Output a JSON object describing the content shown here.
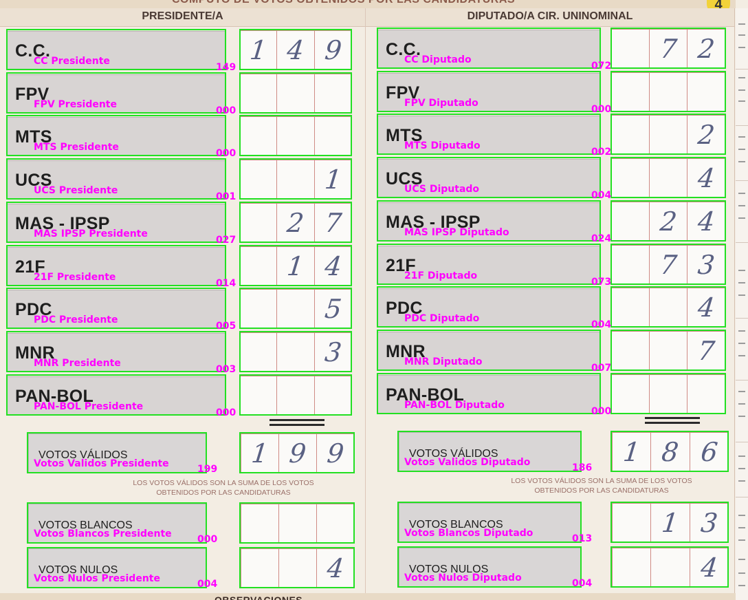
{
  "form": {
    "top_heading": "CÓMPUTO DE VOTOS OBTENIDOS POR LAS CANDIDATURAS",
    "page_number": "4",
    "left_header": "PRESIDENTE/A",
    "right_header": "DIPUTADO/A CIR. UNINOMINAL",
    "bottom_heading": "OBSERVACIONES",
    "note_line1": "LOS VOTOS VÁLIDOS SON LA SUMA DE LOS VOTOS",
    "note_line2": "OBTENIDOS POR LAS CANDIDATURAS"
  },
  "annotation_colors": {
    "box": "#22e022",
    "label": "#ff00ff"
  },
  "presidente": {
    "parties": [
      {
        "party": "C.C.",
        "tag": "CC Presidente",
        "value": "149",
        "digits": [
          "1",
          "4",
          "9"
        ]
      },
      {
        "party": "FPV",
        "tag": "FPV Presidente",
        "value": "000",
        "digits": [
          "",
          "",
          ""
        ]
      },
      {
        "party": "MTS",
        "tag": "MTS Presidente",
        "value": "000",
        "digits": [
          "",
          "",
          ""
        ]
      },
      {
        "party": "UCS",
        "tag": "UCS Presidente",
        "value": "001",
        "digits": [
          "",
          "",
          "1"
        ]
      },
      {
        "party": "MAS - IPSP",
        "tag": "MAS IPSP Presidente",
        "value": "027",
        "digits": [
          "",
          "2",
          "7"
        ]
      },
      {
        "party": "21F",
        "tag": "21F Presidente",
        "value": "014",
        "digits": [
          "",
          "1",
          "4"
        ]
      },
      {
        "party": "PDC",
        "tag": "PDC Presidente",
        "value": "005",
        "digits": [
          "",
          "",
          "5"
        ]
      },
      {
        "party": "MNR",
        "tag": "MNR Presidente",
        "value": "003",
        "digits": [
          "",
          "",
          "3"
        ]
      },
      {
        "party": "PAN-BOL",
        "tag": "PAN-BOL Presidente",
        "value": "000",
        "digits": [
          "",
          "",
          ""
        ]
      }
    ],
    "totals": [
      {
        "label": "VOTOS VÁLIDOS",
        "tag": "Votos Validos Presidente",
        "value": "199",
        "digits": [
          "1",
          "9",
          "9"
        ]
      },
      {
        "label": "VOTOS BLANCOS",
        "tag": "Votos Blancos Presidente",
        "value": "000",
        "digits": [
          "",
          "",
          ""
        ]
      },
      {
        "label": "VOTOS NULOS",
        "tag": "Votos Nulos Presidente",
        "value": "004",
        "digits": [
          "",
          "",
          "4"
        ]
      }
    ]
  },
  "diputado": {
    "parties": [
      {
        "party": "C.C.",
        "tag": "CC Diputado",
        "value": "072",
        "digits": [
          "",
          "7",
          "2"
        ]
      },
      {
        "party": "FPV",
        "tag": "FPV Diputado",
        "value": "000",
        "digits": [
          "",
          "",
          ""
        ]
      },
      {
        "party": "MTS",
        "tag": "MTS Diputado",
        "value": "002",
        "digits": [
          "",
          "",
          "2"
        ]
      },
      {
        "party": "UCS",
        "tag": "UCS Diputado",
        "value": "004",
        "digits": [
          "",
          "",
          "4"
        ]
      },
      {
        "party": "MAS - IPSP",
        "tag": "MAS IPSP Diputado",
        "value": "024",
        "digits": [
          "",
          "2",
          "4"
        ]
      },
      {
        "party": "21F",
        "tag": "21F Diputado",
        "value": "073",
        "digits": [
          "",
          "7",
          "3"
        ]
      },
      {
        "party": "PDC",
        "tag": "PDC Diputado",
        "value": "004",
        "digits": [
          "",
          "",
          "4"
        ]
      },
      {
        "party": "MNR",
        "tag": "MNR Diputado",
        "value": "007",
        "digits": [
          "",
          "",
          "7"
        ]
      },
      {
        "party": "PAN-BOL",
        "tag": "PAN-BOL Diputado",
        "value": "000",
        "digits": [
          "",
          "",
          ""
        ]
      }
    ],
    "totals": [
      {
        "label": "VOTOS VÁLIDOS",
        "tag": "Votos Validos Diputado",
        "value": "186",
        "digits": [
          "1",
          "8",
          "6"
        ]
      },
      {
        "label": "VOTOS BLANCOS",
        "tag": "Votos Blancos Diputado",
        "value": "013",
        "digits": [
          "",
          "1",
          "3"
        ]
      },
      {
        "label": "VOTOS NULOS",
        "tag": "Votos Nulos Diputado",
        "value": "004",
        "digits": [
          "",
          "",
          "4"
        ]
      }
    ]
  }
}
